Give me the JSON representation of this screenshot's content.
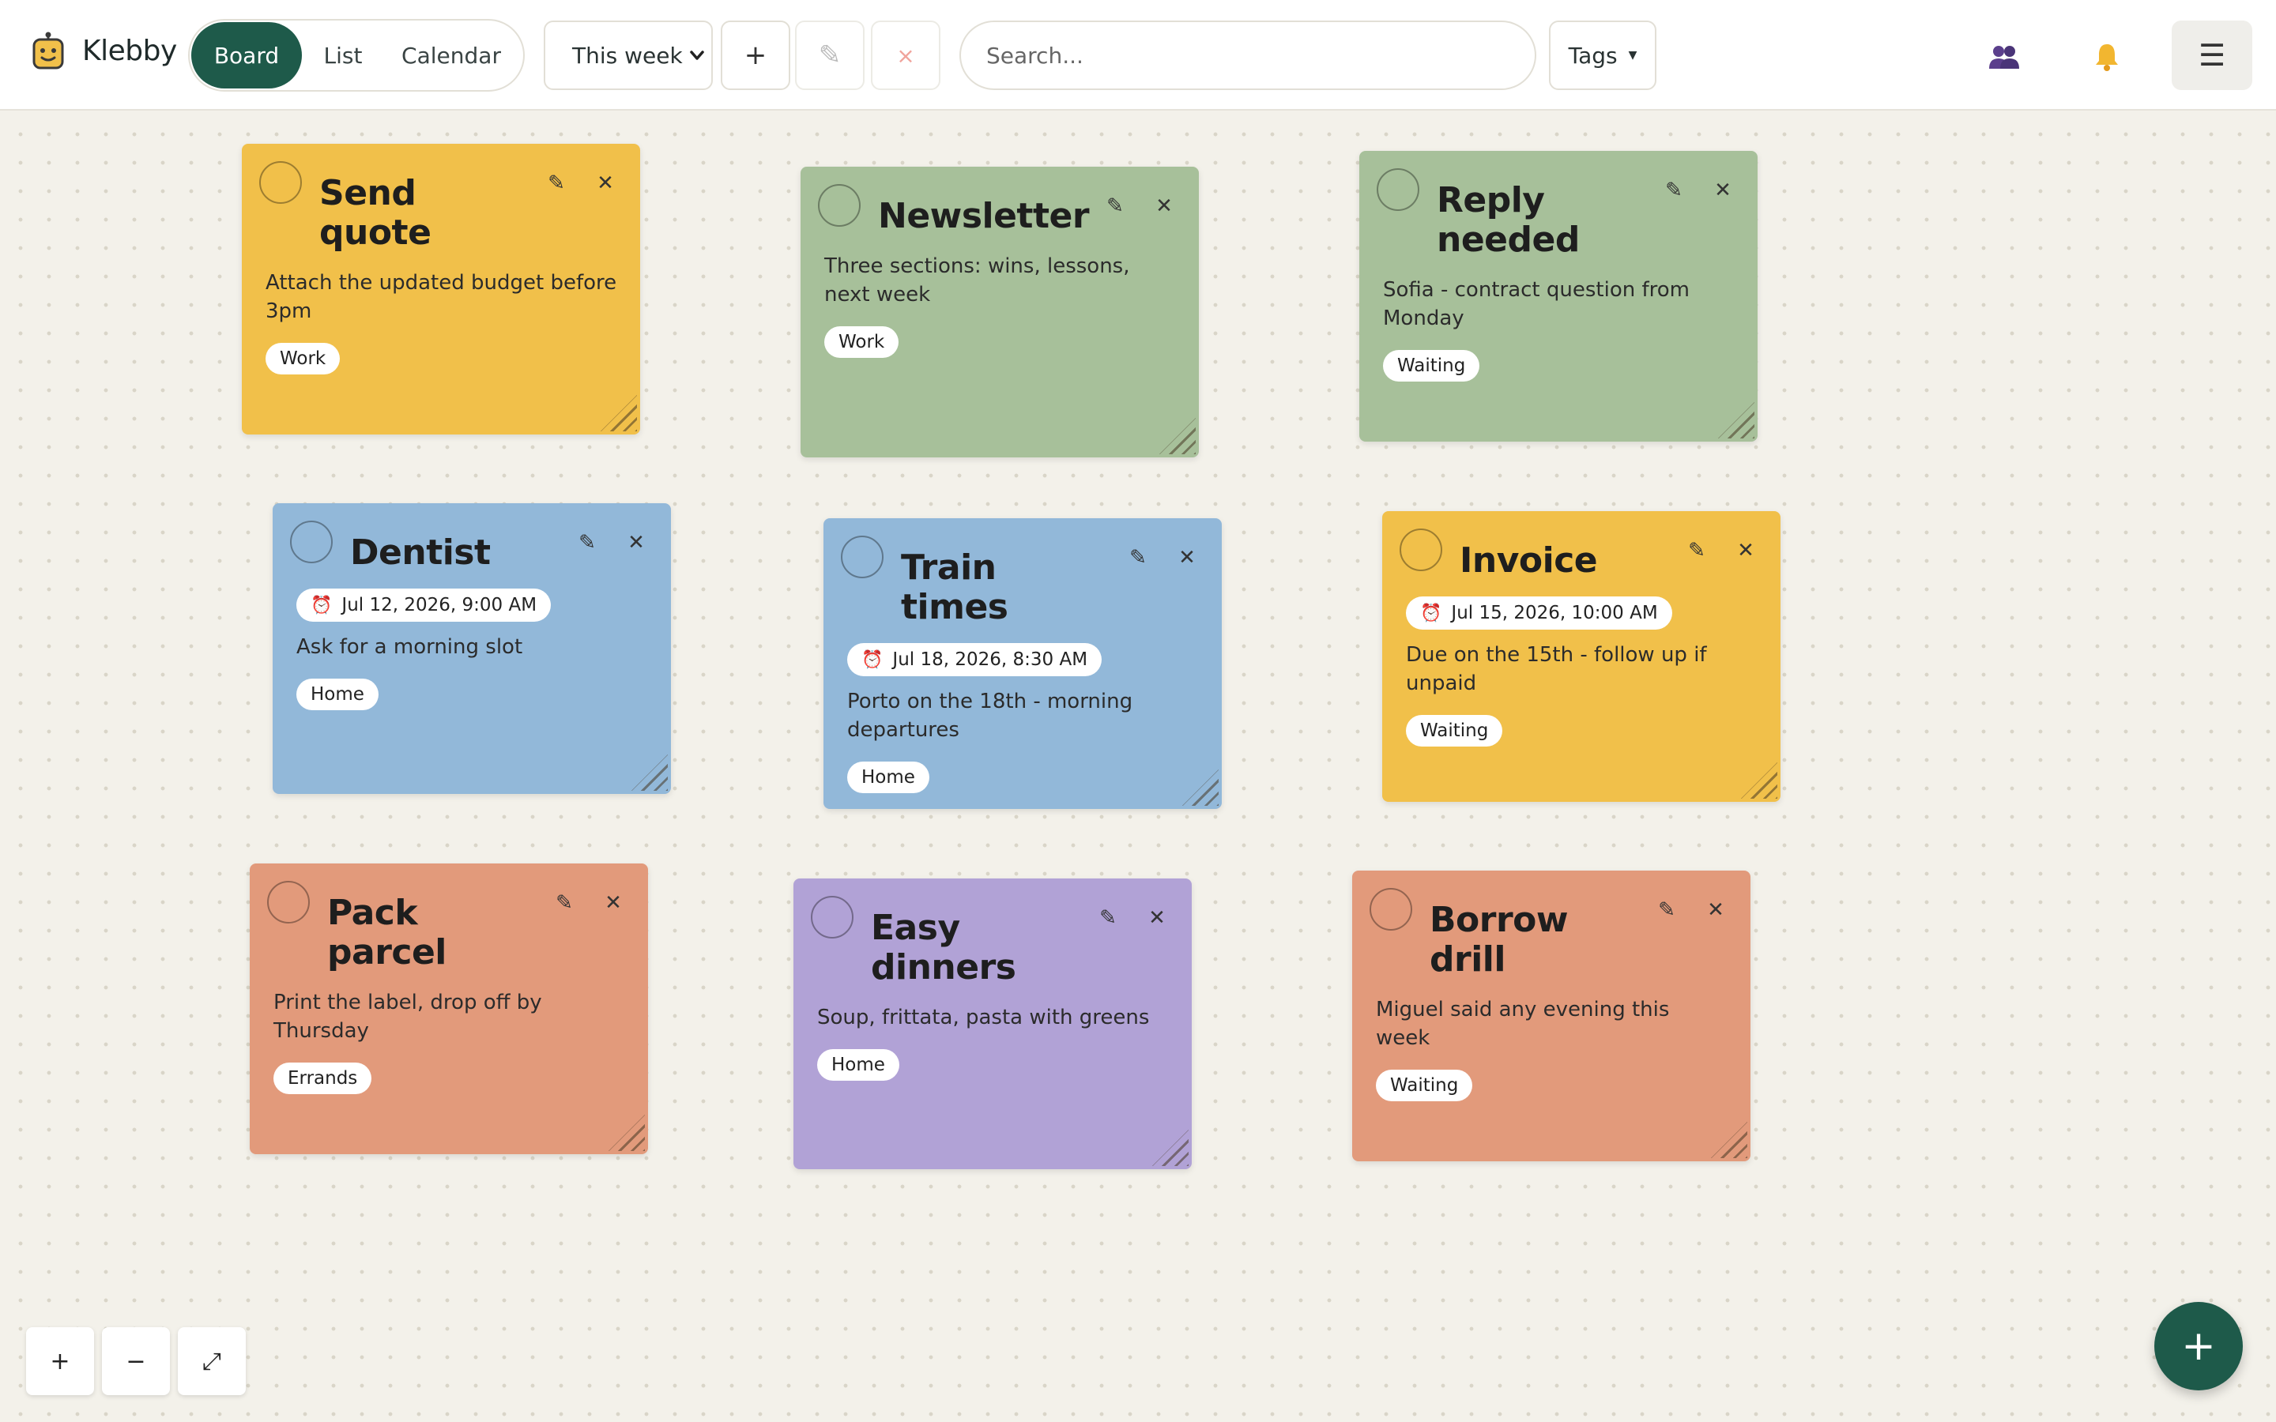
{
  "app": {
    "name": "Klebby"
  },
  "views": {
    "board": "Board",
    "list": "List",
    "calendar": "Calendar",
    "active": "Board"
  },
  "toolbar": {
    "period": "This week",
    "add_label": "+",
    "edit_label": "✎",
    "delete_label": "×",
    "search_placeholder": "Search...",
    "tags_label": "Tags",
    "menu_label": "☰"
  },
  "notes": [
    {
      "color": "#f1c04a",
      "title": "Send quote",
      "reminder": "",
      "body": "Attach the updated budget before 3pm",
      "tag": "Work"
    },
    {
      "color": "#a7c09a",
      "title": "Newsletter",
      "reminder": "",
      "body": "Three sections: wins, lessons, next week",
      "tag": "Work"
    },
    {
      "color": "#a7c09a",
      "title": "Reply needed",
      "reminder": "",
      "body": "Sofia - contract question from Monday",
      "tag": "Waiting"
    },
    {
      "color": "#92b8d9",
      "title": "Dentist",
      "reminder": "Jul 12, 2026, 9:00 AM",
      "body": "Ask for a morning slot",
      "tag": "Home"
    },
    {
      "color": "#92b8d9",
      "title": "Train times",
      "reminder": "Jul 18, 2026, 8:30 AM",
      "body": "Porto on the 18th - morning departures",
      "tag": "Home"
    },
    {
      "color": "#f1c04a",
      "title": "Invoice",
      "reminder": "Jul 15, 2026, 10:00 AM",
      "body": "Due on the 15th - follow up if unpaid",
      "tag": "Waiting"
    },
    {
      "color": "#e29a7b",
      "title": "Pack parcel",
      "reminder": "",
      "body": "Print the label, drop off by Thursday",
      "tag": "Errands"
    },
    {
      "color": "#b1a2d6",
      "title": "Easy dinners",
      "reminder": "",
      "body": "Soup, frittata, pasta with greens",
      "tag": "Home"
    },
    {
      "color": "#e29a7b",
      "title": "Borrow drill",
      "reminder": "",
      "body": "Miguel said any evening this week",
      "tag": "Waiting"
    }
  ],
  "zoom": {
    "in": "+",
    "out": "−",
    "fit": "⤢"
  },
  "fab": {
    "label": "+"
  },
  "icons": {
    "logo": "robot-icon",
    "people": "people-icon",
    "bell": "bell-icon"
  },
  "colors": {
    "accent": "#1e5a4a",
    "alarm": "#e0506a"
  }
}
